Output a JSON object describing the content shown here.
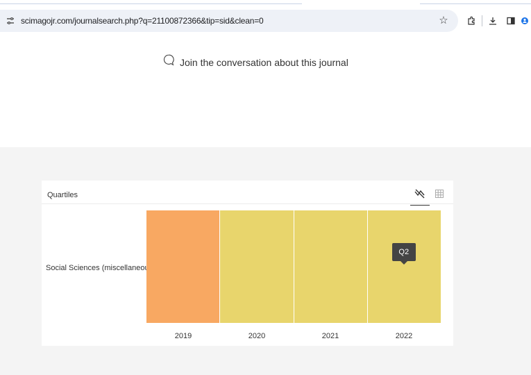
{
  "browser": {
    "url": "scimagojr.com/journalsearch.php?q=21100872366&tip=sid&clean=0",
    "icons": [
      "tune-icon",
      "bookmark-star-icon",
      "extensions-icon",
      "download-icon",
      "sidepanel-icon",
      "profile-icon"
    ]
  },
  "conversation": {
    "label": "Join the conversation about this journal",
    "icon": "speech-bubble-icon"
  },
  "quartiles": {
    "title": "Quartiles",
    "tools": [
      "chart-view-icon",
      "table-view-icon"
    ],
    "row_label": "Social Sciences (miscellaneous)",
    "tooltip": "Q2",
    "colors": {
      "Q2": "#e8d56c",
      "Q3": "#f8a862"
    }
  },
  "chart_data": {
    "type": "heatmap",
    "title": "Quartiles",
    "categories": [
      "2019",
      "2020",
      "2021",
      "2022"
    ],
    "rows": [
      "Social Sciences (miscellaneous)"
    ],
    "series": [
      {
        "values": [
          "Q3",
          "Q2",
          "Q2",
          "Q2"
        ]
      }
    ]
  }
}
